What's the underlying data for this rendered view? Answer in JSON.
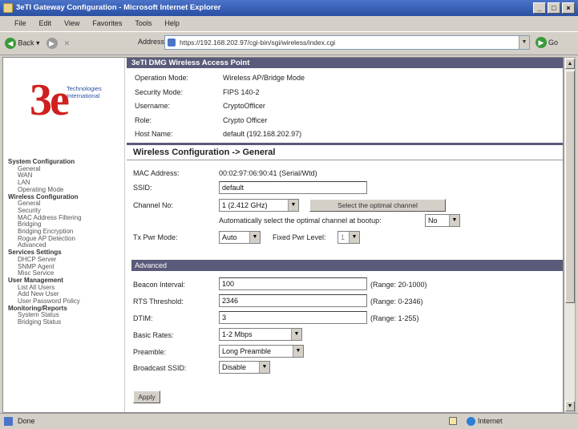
{
  "window": {
    "title": "3eTI Gateway Configuration - Microsoft Internet Explorer"
  },
  "menu": [
    "File",
    "Edit",
    "View",
    "Favorites",
    "Tools",
    "Help"
  ],
  "toolbar": {
    "back_label": "Back",
    "address_label": "Address",
    "address_url": "https://192.168.202.97/cgi-bin/sgi/wireless/index.cgi",
    "go_label": "Go"
  },
  "status": {
    "left": "Done",
    "zone": "Internet"
  },
  "logo": {
    "mark": "3e",
    "tagline": "Technologies International"
  },
  "nav": [
    {
      "kind": "grp",
      "label": "System Configuration"
    },
    {
      "kind": "it",
      "label": "General"
    },
    {
      "kind": "it",
      "label": "WAN"
    },
    {
      "kind": "it",
      "label": "LAN"
    },
    {
      "kind": "it",
      "label": "Operating Mode"
    },
    {
      "kind": "grp",
      "label": "Wireless Configuration"
    },
    {
      "kind": "it",
      "label": "General"
    },
    {
      "kind": "it",
      "label": "Security"
    },
    {
      "kind": "it",
      "label": "MAC Address Filtering"
    },
    {
      "kind": "it",
      "label": "Bridging"
    },
    {
      "kind": "it",
      "label": "Bridging Encryption"
    },
    {
      "kind": "it",
      "label": "Rogue AP Detection"
    },
    {
      "kind": "it",
      "label": "Advanced"
    },
    {
      "kind": "grp",
      "label": "Services Settings"
    },
    {
      "kind": "it",
      "label": "DHCP Server"
    },
    {
      "kind": "it",
      "label": "SNMP Agent"
    },
    {
      "kind": "it",
      "label": "Misc Service"
    },
    {
      "kind": "grp",
      "label": "User Management"
    },
    {
      "kind": "it",
      "label": "List All Users"
    },
    {
      "kind": "it",
      "label": "Add New User"
    },
    {
      "kind": "it",
      "label": "User Password Policy"
    },
    {
      "kind": "grp",
      "label": "Monitoring/Reports"
    },
    {
      "kind": "it",
      "label": "System Status"
    },
    {
      "kind": "it",
      "label": "Bridging Status"
    }
  ],
  "header": "3eTI DMG Wireless Access Point",
  "info": [
    {
      "k": "Operation Mode:",
      "v": "Wireless AP/Bridge Mode"
    },
    {
      "k": "Security Mode:",
      "v": "FIPS 140-2"
    },
    {
      "k": "Username:",
      "v": "CryptoOfficer"
    },
    {
      "k": "Role:",
      "v": "Crypto Officer"
    },
    {
      "k": "Host Name:",
      "v": "default (192.168.202.97)"
    }
  ],
  "section_title": "Wireless Configuration -> General",
  "general": {
    "mac_label": "MAC Address:",
    "mac_value": "00:02:97:06:90:41 (Serial/Wtd)",
    "ssid_label": "SSID:",
    "ssid_value": "default",
    "channel_label": "Channel No:",
    "channel_value": "1 (2.412 GHz)",
    "select_channel_btn": "Select the optimal channel",
    "auto_select_label": "Automatically select the optimal channel at bootup:",
    "auto_select_value": "No",
    "txpwr_label": "Tx Pwr Mode:",
    "txpwr_value": "Auto",
    "fixed_pwr_label": "Fixed Pwr Level:",
    "fixed_pwr_value": "1"
  },
  "advanced": {
    "title": "Advanced",
    "beacon_label": "Beacon Interval:",
    "beacon_value": "100",
    "beacon_range": "(Range: 20-1000)",
    "rts_label": "RTS Threshold:",
    "rts_value": "2346",
    "rts_range": "(Range: 0-2346)",
    "dtim_label": "DTIM:",
    "dtim_value": "3",
    "dtim_range": "(Range: 1-255)",
    "rates_label": "Basic Rates:",
    "rates_value": "1-2 Mbps",
    "preamble_label": "Preamble:",
    "preamble_value": "Long Preamble",
    "bcast_label": "Broadcast SSID:",
    "bcast_value": "Disable"
  },
  "apply_label": "Apply"
}
